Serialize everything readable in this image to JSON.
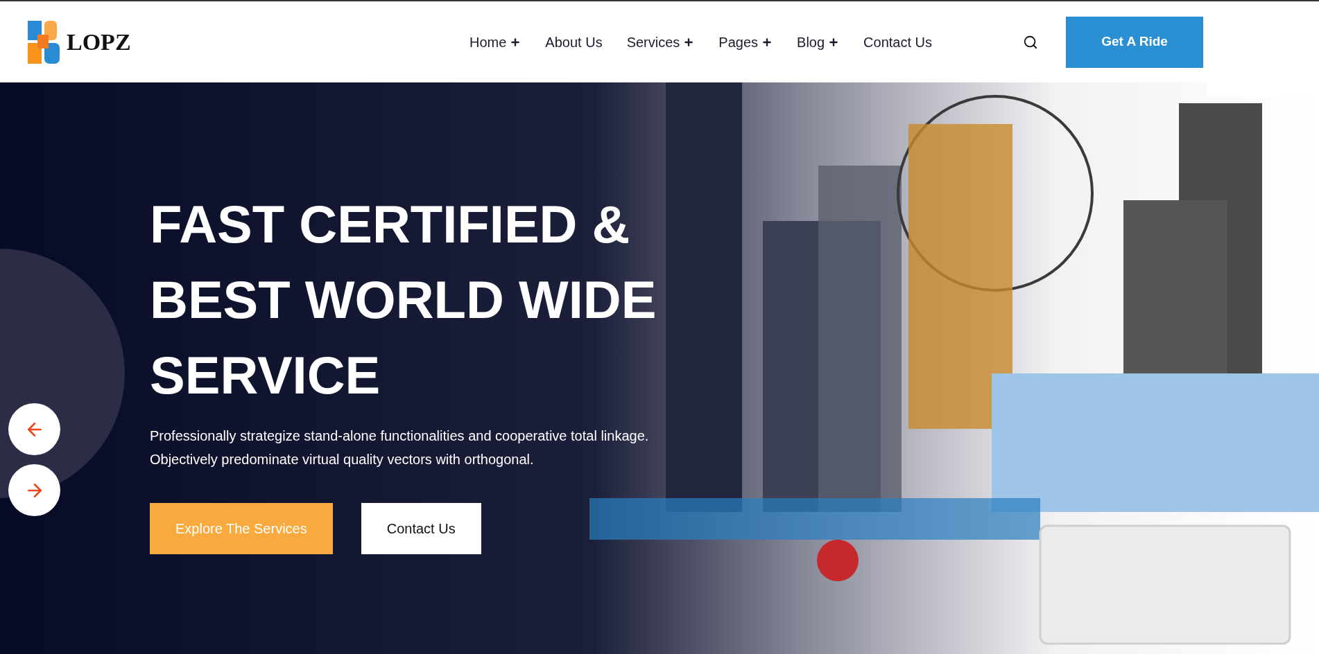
{
  "header": {
    "logo_text": "LOPZ",
    "nav": [
      {
        "label": "Home",
        "has_submenu": true
      },
      {
        "label": "About Us",
        "has_submenu": false
      },
      {
        "label": "Services",
        "has_submenu": true
      },
      {
        "label": "Pages",
        "has_submenu": true
      },
      {
        "label": "Blog",
        "has_submenu": true
      },
      {
        "label": "Contact Us",
        "has_submenu": false
      }
    ],
    "cta": "Get A Ride"
  },
  "hero": {
    "title_lines": [
      "FAST CERTIFIED &",
      "BEST WORLD WIDE",
      "SERVICE"
    ],
    "description_lines": [
      "Professionally strategize stand-alone functionalities and cooperative total linkage.",
      "Objectively predominate virtual quality vectors with orthogonal."
    ],
    "buttons": [
      {
        "label": "Explore The Services",
        "kind": "primary"
      },
      {
        "label": "Contact Us",
        "kind": "secondary"
      }
    ],
    "slider_arrows": [
      {
        "kind": "previous"
      },
      {
        "kind": "next"
      }
    ]
  }
}
